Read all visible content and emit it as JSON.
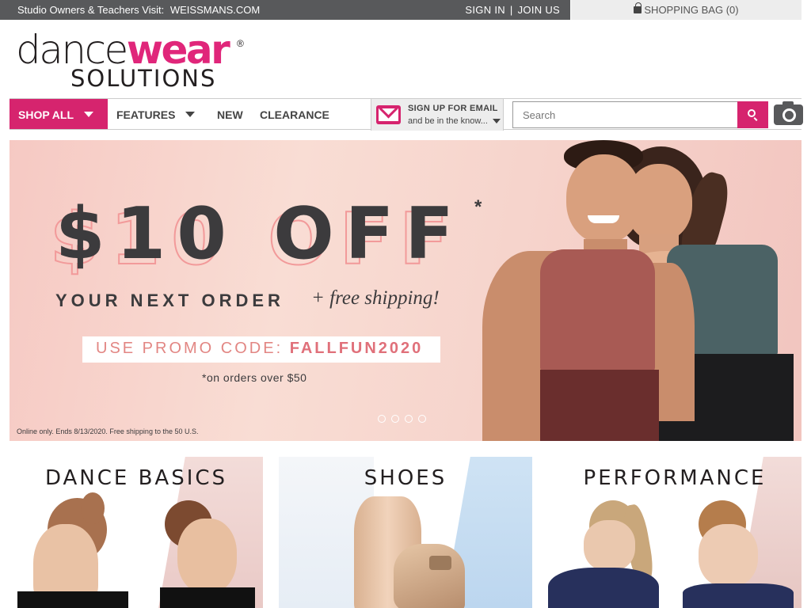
{
  "topbar": {
    "studio_text": "Studio Owners & Teachers Visit:",
    "studio_link": "WEISSMANS.COM",
    "sign_in": "SIGN IN",
    "separator": "|",
    "join_us": "JOIN US",
    "bag_label": "SHOPPING BAG (0)"
  },
  "logo": {
    "line1_a": "dance",
    "line1_b": "wear",
    "registered": "®",
    "line2": "SOLUTIONS"
  },
  "nav": {
    "shop_all": "SHOP ALL",
    "features": "FEATURES",
    "new": "NEW",
    "clearance": "CLEARANCE",
    "email_title": "SIGN UP FOR EMAIL",
    "email_sub": "and be in the know...",
    "search_placeholder": "Search"
  },
  "hero": {
    "offer": "$10 OFF",
    "asterisk": "*",
    "next_order": "YOUR NEXT ORDER",
    "free_shipping": "+ free shipping!",
    "promo_label": "USE PROMO CODE:",
    "promo_code": "FALLFUN2020",
    "minimum": "*on orders over $50",
    "fine_print": "Online only. Ends 8/13/2020. Free shipping to the 50 U.S.",
    "slide_count": 4
  },
  "categories": [
    {
      "title": "DANCE BASICS"
    },
    {
      "title": "SHOES"
    },
    {
      "title": "PERFORMANCE"
    }
  ],
  "colors": {
    "brand_pink": "#d6246e",
    "topbar_gray": "#58595b",
    "hero_text": "#3c3b3d"
  }
}
